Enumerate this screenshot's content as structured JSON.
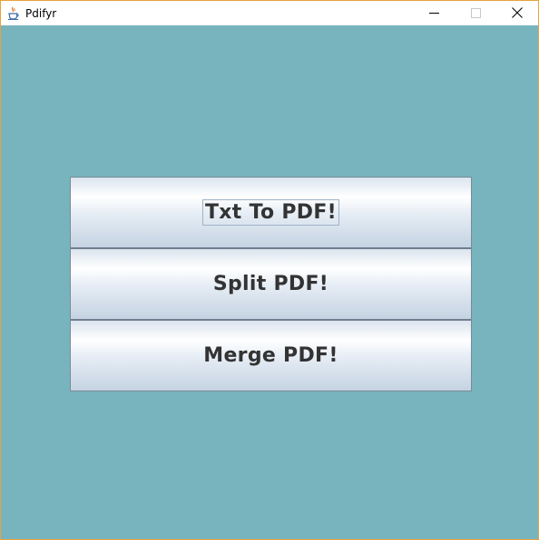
{
  "window": {
    "title": "Pdifyr",
    "controls": {
      "minimize_icon": "minimize-icon",
      "maximize_icon": "maximize-icon",
      "close_icon": "close-icon"
    }
  },
  "main": {
    "buttons": [
      {
        "label": "Txt To PDF!",
        "focused": true
      },
      {
        "label": "Split PDF!",
        "focused": false
      },
      {
        "label": "Merge PDF!",
        "focused": false
      }
    ]
  },
  "colors": {
    "background": "#78b4bd",
    "window_border": "#e8a33d",
    "button_text": "#333333"
  }
}
